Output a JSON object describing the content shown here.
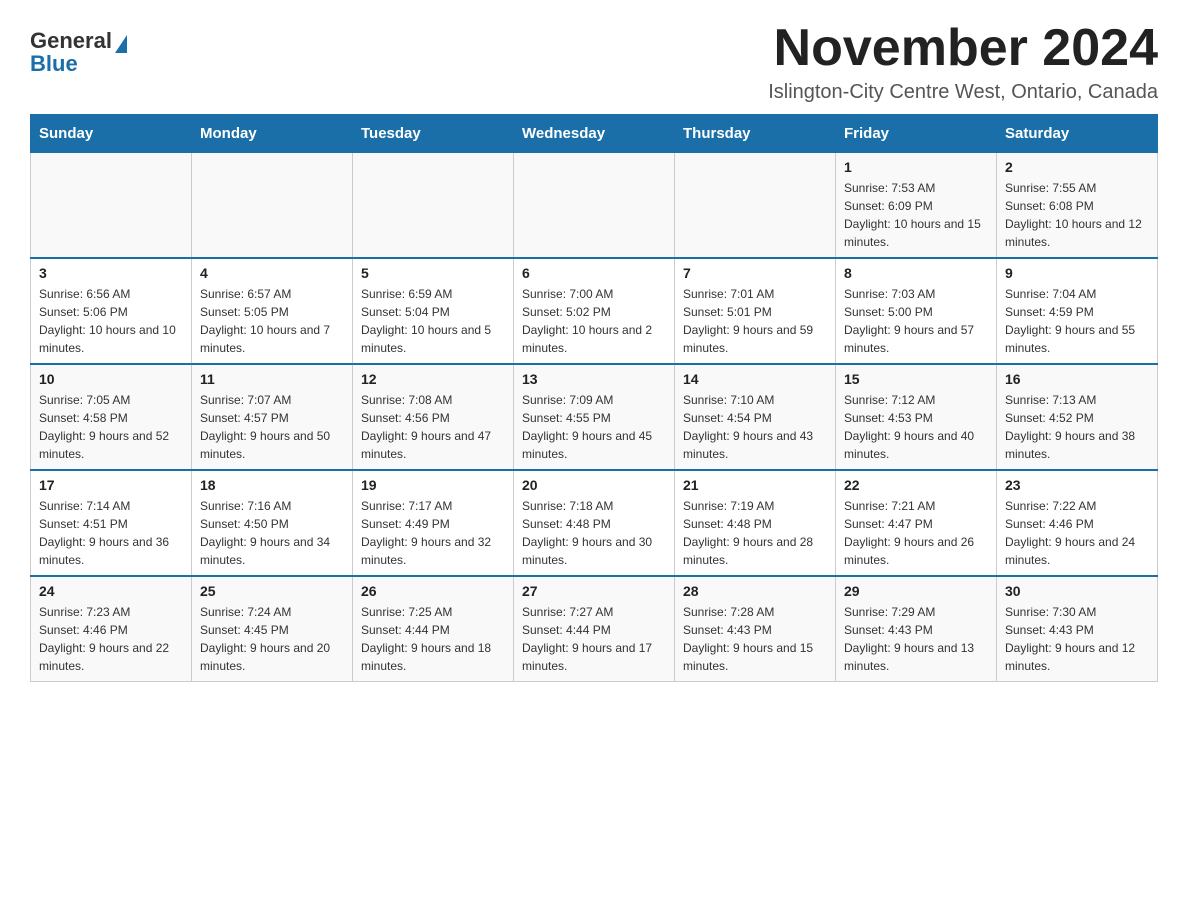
{
  "logo": {
    "general": "General",
    "blue": "Blue"
  },
  "title": "November 2024",
  "location": "Islington-City Centre West, Ontario, Canada",
  "days_of_week": [
    "Sunday",
    "Monday",
    "Tuesday",
    "Wednesday",
    "Thursday",
    "Friday",
    "Saturday"
  ],
  "weeks": [
    [
      {
        "day": "",
        "sunrise": "",
        "sunset": "",
        "daylight": "",
        "empty": true
      },
      {
        "day": "",
        "sunrise": "",
        "sunset": "",
        "daylight": "",
        "empty": true
      },
      {
        "day": "",
        "sunrise": "",
        "sunset": "",
        "daylight": "",
        "empty": true
      },
      {
        "day": "",
        "sunrise": "",
        "sunset": "",
        "daylight": "",
        "empty": true
      },
      {
        "day": "",
        "sunrise": "",
        "sunset": "",
        "daylight": "",
        "empty": true
      },
      {
        "day": "1",
        "sunrise": "Sunrise: 7:53 AM",
        "sunset": "Sunset: 6:09 PM",
        "daylight": "Daylight: 10 hours and 15 minutes.",
        "empty": false
      },
      {
        "day": "2",
        "sunrise": "Sunrise: 7:55 AM",
        "sunset": "Sunset: 6:08 PM",
        "daylight": "Daylight: 10 hours and 12 minutes.",
        "empty": false
      }
    ],
    [
      {
        "day": "3",
        "sunrise": "Sunrise: 6:56 AM",
        "sunset": "Sunset: 5:06 PM",
        "daylight": "Daylight: 10 hours and 10 minutes.",
        "empty": false
      },
      {
        "day": "4",
        "sunrise": "Sunrise: 6:57 AM",
        "sunset": "Sunset: 5:05 PM",
        "daylight": "Daylight: 10 hours and 7 minutes.",
        "empty": false
      },
      {
        "day": "5",
        "sunrise": "Sunrise: 6:59 AM",
        "sunset": "Sunset: 5:04 PM",
        "daylight": "Daylight: 10 hours and 5 minutes.",
        "empty": false
      },
      {
        "day": "6",
        "sunrise": "Sunrise: 7:00 AM",
        "sunset": "Sunset: 5:02 PM",
        "daylight": "Daylight: 10 hours and 2 minutes.",
        "empty": false
      },
      {
        "day": "7",
        "sunrise": "Sunrise: 7:01 AM",
        "sunset": "Sunset: 5:01 PM",
        "daylight": "Daylight: 9 hours and 59 minutes.",
        "empty": false
      },
      {
        "day": "8",
        "sunrise": "Sunrise: 7:03 AM",
        "sunset": "Sunset: 5:00 PM",
        "daylight": "Daylight: 9 hours and 57 minutes.",
        "empty": false
      },
      {
        "day": "9",
        "sunrise": "Sunrise: 7:04 AM",
        "sunset": "Sunset: 4:59 PM",
        "daylight": "Daylight: 9 hours and 55 minutes.",
        "empty": false
      }
    ],
    [
      {
        "day": "10",
        "sunrise": "Sunrise: 7:05 AM",
        "sunset": "Sunset: 4:58 PM",
        "daylight": "Daylight: 9 hours and 52 minutes.",
        "empty": false
      },
      {
        "day": "11",
        "sunrise": "Sunrise: 7:07 AM",
        "sunset": "Sunset: 4:57 PM",
        "daylight": "Daylight: 9 hours and 50 minutes.",
        "empty": false
      },
      {
        "day": "12",
        "sunrise": "Sunrise: 7:08 AM",
        "sunset": "Sunset: 4:56 PM",
        "daylight": "Daylight: 9 hours and 47 minutes.",
        "empty": false
      },
      {
        "day": "13",
        "sunrise": "Sunrise: 7:09 AM",
        "sunset": "Sunset: 4:55 PM",
        "daylight": "Daylight: 9 hours and 45 minutes.",
        "empty": false
      },
      {
        "day": "14",
        "sunrise": "Sunrise: 7:10 AM",
        "sunset": "Sunset: 4:54 PM",
        "daylight": "Daylight: 9 hours and 43 minutes.",
        "empty": false
      },
      {
        "day": "15",
        "sunrise": "Sunrise: 7:12 AM",
        "sunset": "Sunset: 4:53 PM",
        "daylight": "Daylight: 9 hours and 40 minutes.",
        "empty": false
      },
      {
        "day": "16",
        "sunrise": "Sunrise: 7:13 AM",
        "sunset": "Sunset: 4:52 PM",
        "daylight": "Daylight: 9 hours and 38 minutes.",
        "empty": false
      }
    ],
    [
      {
        "day": "17",
        "sunrise": "Sunrise: 7:14 AM",
        "sunset": "Sunset: 4:51 PM",
        "daylight": "Daylight: 9 hours and 36 minutes.",
        "empty": false
      },
      {
        "day": "18",
        "sunrise": "Sunrise: 7:16 AM",
        "sunset": "Sunset: 4:50 PM",
        "daylight": "Daylight: 9 hours and 34 minutes.",
        "empty": false
      },
      {
        "day": "19",
        "sunrise": "Sunrise: 7:17 AM",
        "sunset": "Sunset: 4:49 PM",
        "daylight": "Daylight: 9 hours and 32 minutes.",
        "empty": false
      },
      {
        "day": "20",
        "sunrise": "Sunrise: 7:18 AM",
        "sunset": "Sunset: 4:48 PM",
        "daylight": "Daylight: 9 hours and 30 minutes.",
        "empty": false
      },
      {
        "day": "21",
        "sunrise": "Sunrise: 7:19 AM",
        "sunset": "Sunset: 4:48 PM",
        "daylight": "Daylight: 9 hours and 28 minutes.",
        "empty": false
      },
      {
        "day": "22",
        "sunrise": "Sunrise: 7:21 AM",
        "sunset": "Sunset: 4:47 PM",
        "daylight": "Daylight: 9 hours and 26 minutes.",
        "empty": false
      },
      {
        "day": "23",
        "sunrise": "Sunrise: 7:22 AM",
        "sunset": "Sunset: 4:46 PM",
        "daylight": "Daylight: 9 hours and 24 minutes.",
        "empty": false
      }
    ],
    [
      {
        "day": "24",
        "sunrise": "Sunrise: 7:23 AM",
        "sunset": "Sunset: 4:46 PM",
        "daylight": "Daylight: 9 hours and 22 minutes.",
        "empty": false
      },
      {
        "day": "25",
        "sunrise": "Sunrise: 7:24 AM",
        "sunset": "Sunset: 4:45 PM",
        "daylight": "Daylight: 9 hours and 20 minutes.",
        "empty": false
      },
      {
        "day": "26",
        "sunrise": "Sunrise: 7:25 AM",
        "sunset": "Sunset: 4:44 PM",
        "daylight": "Daylight: 9 hours and 18 minutes.",
        "empty": false
      },
      {
        "day": "27",
        "sunrise": "Sunrise: 7:27 AM",
        "sunset": "Sunset: 4:44 PM",
        "daylight": "Daylight: 9 hours and 17 minutes.",
        "empty": false
      },
      {
        "day": "28",
        "sunrise": "Sunrise: 7:28 AM",
        "sunset": "Sunset: 4:43 PM",
        "daylight": "Daylight: 9 hours and 15 minutes.",
        "empty": false
      },
      {
        "day": "29",
        "sunrise": "Sunrise: 7:29 AM",
        "sunset": "Sunset: 4:43 PM",
        "daylight": "Daylight: 9 hours and 13 minutes.",
        "empty": false
      },
      {
        "day": "30",
        "sunrise": "Sunrise: 7:30 AM",
        "sunset": "Sunset: 4:43 PM",
        "daylight": "Daylight: 9 hours and 12 minutes.",
        "empty": false
      }
    ]
  ]
}
